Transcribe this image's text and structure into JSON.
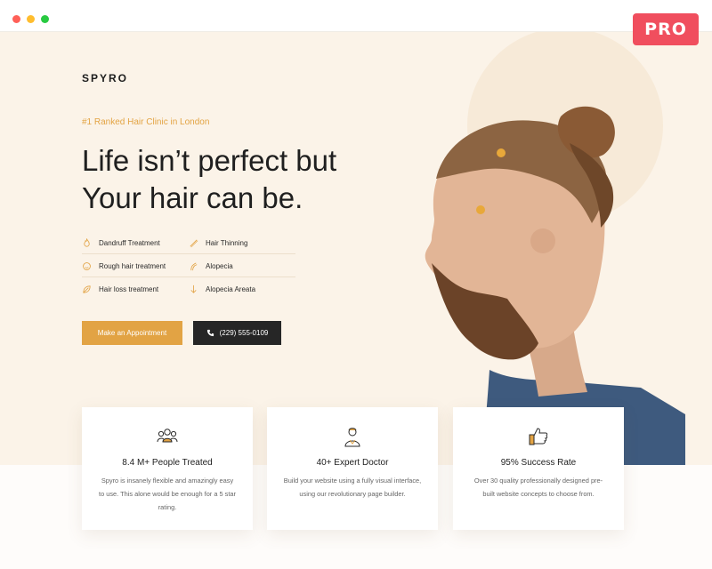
{
  "window": {
    "badge": "PRO"
  },
  "brand": {
    "logo": "SPYRO"
  },
  "hero": {
    "tagline": "#1 Ranked Hair Clinic in London",
    "headline_line1": "Life isn’t perfect but",
    "headline_line2": "Your hair can be."
  },
  "services": [
    {
      "label": "Dandruff Treatment",
      "icon": "flame-icon"
    },
    {
      "label": "Hair Thinning",
      "icon": "comb-icon"
    },
    {
      "label": "Rough hair treatment",
      "icon": "face-icon"
    },
    {
      "label": "Alopecia",
      "icon": "hair-strand-icon"
    },
    {
      "label": "Hair loss treatment",
      "icon": "leaf-icon"
    },
    {
      "label": "Alopecia Areata",
      "icon": "drop-arrow-icon"
    }
  ],
  "buttons": {
    "appointment": "Make an Appointment",
    "phone": "(229) 555-0109"
  },
  "features": [
    {
      "title": "8.4 M+ People Treated",
      "text": "Spyro is insanely flexible and amazingly easy to use. This alone would be enough for a 5 star rating.",
      "icon": "people-icon"
    },
    {
      "title": "40+ Expert Doctor",
      "text": "Build your website using a fully visual interface, using our revolutionary page builder.",
      "icon": "doctor-icon"
    },
    {
      "title": "95% Success Rate",
      "text": "Over 30 quality professionally designed pre-built website concepts to choose from.",
      "icon": "thumbs-up-icon"
    }
  ],
  "colors": {
    "accent": "#e2a344",
    "hero_bg": "#fbf3e8",
    "badge": "#f04e5e",
    "dark_button": "#262626"
  }
}
